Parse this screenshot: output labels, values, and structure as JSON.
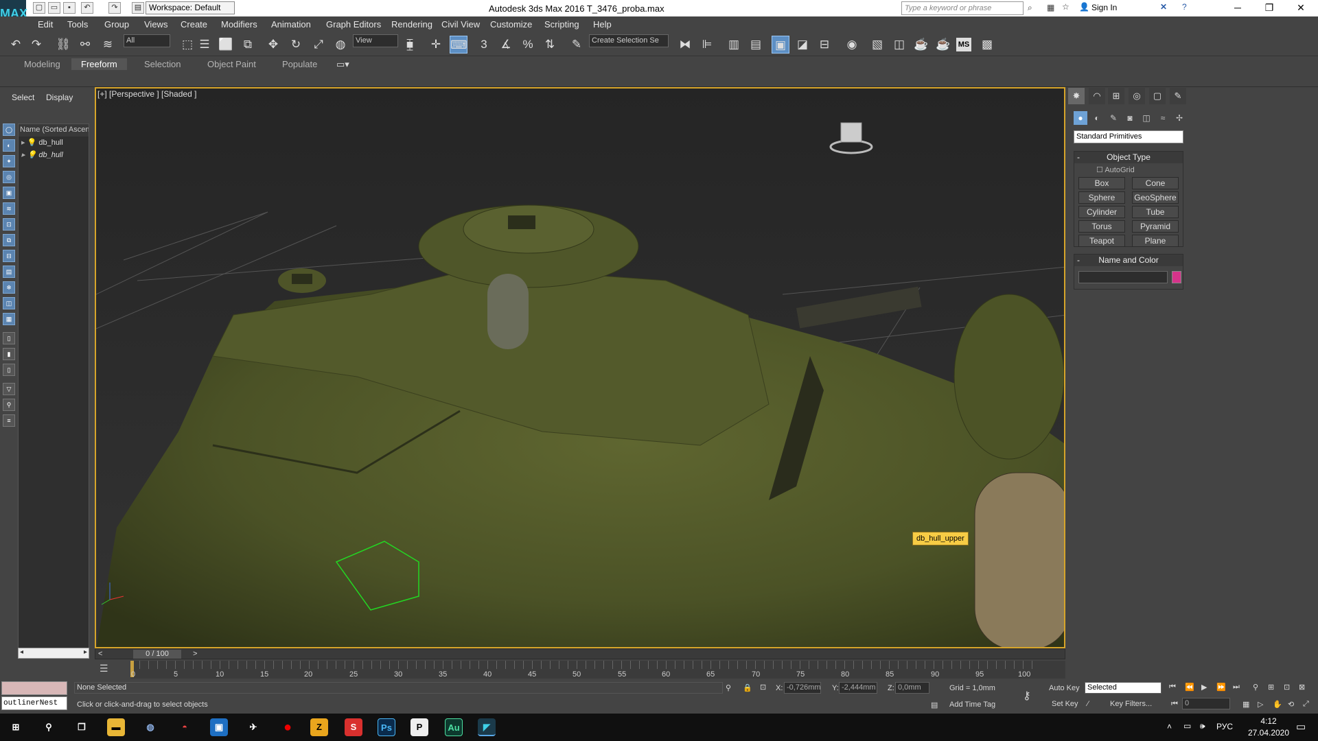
{
  "window": {
    "title": "Autodesk 3ds Max 2016    T_3476_proba.max",
    "workspace": "Workspace: Default",
    "search_placeholder": "Type a keyword or phrase",
    "sign_in": "Sign In",
    "logo": "MAX"
  },
  "menu": [
    "Edit",
    "Tools",
    "Group",
    "Views",
    "Create",
    "Modifiers",
    "Animation",
    "Graph Editors",
    "Rendering",
    "Civil View",
    "Customize",
    "Scripting",
    "Help"
  ],
  "toolbar": {
    "filter": "All",
    "ref_coord": "View",
    "selection_set": "Create Selection Se",
    "ms_label": "MS"
  },
  "ribbon_tabs": [
    "Modeling",
    "Freeform",
    "Selection",
    "Object Paint",
    "Populate"
  ],
  "scene_explorer": {
    "tabs": [
      "Select",
      "Display"
    ],
    "header": "Name (Sorted Ascen",
    "items": [
      "db_hull",
      "db_hull"
    ]
  },
  "viewport": {
    "label": "[+] [Perspective ] [Shaded ]",
    "tooltip": "db_hull_upper"
  },
  "command_panel": {
    "category": "Standard Primitives",
    "object_type": {
      "title": "Object Type",
      "autogrid": "AutoGrid",
      "buttons": [
        "Box",
        "Cone",
        "Sphere",
        "GeoSphere",
        "Cylinder",
        "Tube",
        "Torus",
        "Pyramid",
        "Teapot",
        "Plane"
      ]
    },
    "name_color": {
      "title": "Name and Color",
      "swatch": "#d6338a"
    }
  },
  "timeline": {
    "frame": "0 / 100",
    "ticks": [
      "0",
      "5",
      "10",
      "15",
      "20",
      "25",
      "30",
      "35",
      "40",
      "45",
      "50",
      "55",
      "60",
      "65",
      "70",
      "75",
      "80",
      "85",
      "90",
      "95",
      "100"
    ]
  },
  "status": {
    "selection": "None Selected",
    "prompt": "Click or click-and-drag to select objects",
    "x": "-0,726mm",
    "y": "-2,444mm",
    "z": "0,0mm",
    "grid": "Grid = 1,0mm",
    "add_time_tag": "Add Time Tag",
    "auto_key": "Auto Key",
    "set_key": "Set Key",
    "selected": "Selected",
    "key_filters": "Key Filters...",
    "frame_field": "0",
    "maxscript": "outlinerNest"
  },
  "taskbar": {
    "lang": "РУС",
    "time": "4:12",
    "date": "27.04.2020",
    "apps": [
      "Ps",
      "P",
      "Au",
      "Z"
    ]
  }
}
